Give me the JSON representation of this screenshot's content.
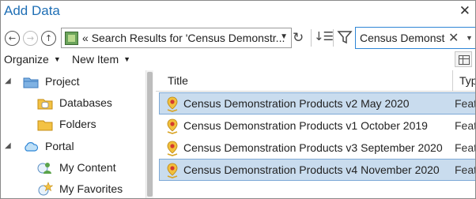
{
  "window": {
    "title": "Add Data"
  },
  "nav": {
    "path_prefix": "«",
    "path_text": "Search Results for 'Census Demonstr...",
    "search_value": "Census Demonstr"
  },
  "menu": {
    "organize": "Organize",
    "new_item": "New Item"
  },
  "tree": [
    {
      "label": "Project",
      "icon": "folder-icon"
    },
    {
      "label": "Databases",
      "icon": "database-folder-icon"
    },
    {
      "label": "Folders",
      "icon": "folder-icon"
    },
    {
      "label": "Portal",
      "icon": "cloud-icon"
    },
    {
      "label": "My Content",
      "icon": "user-icon"
    },
    {
      "label": "My Favorites",
      "icon": "star-icon"
    }
  ],
  "list": {
    "columns": {
      "title": "Title",
      "type": "Typ"
    },
    "rows": [
      {
        "title": "Census Demonstration Products v2 May 2020",
        "type": "Feat",
        "selected": true
      },
      {
        "title": "Census Demonstration Products v1 October 2019",
        "type": "Feat",
        "selected": false
      },
      {
        "title": "Census Demonstration Products v3 September 2020",
        "type": "Feat",
        "selected": false
      },
      {
        "title": "Census Demonstration Products v4 November 2020",
        "type": "Feat",
        "selected": true
      }
    ]
  },
  "colors": {
    "accent": "#1f6fb5",
    "selection": "#c9dcee",
    "search_border": "#2f86d6"
  }
}
